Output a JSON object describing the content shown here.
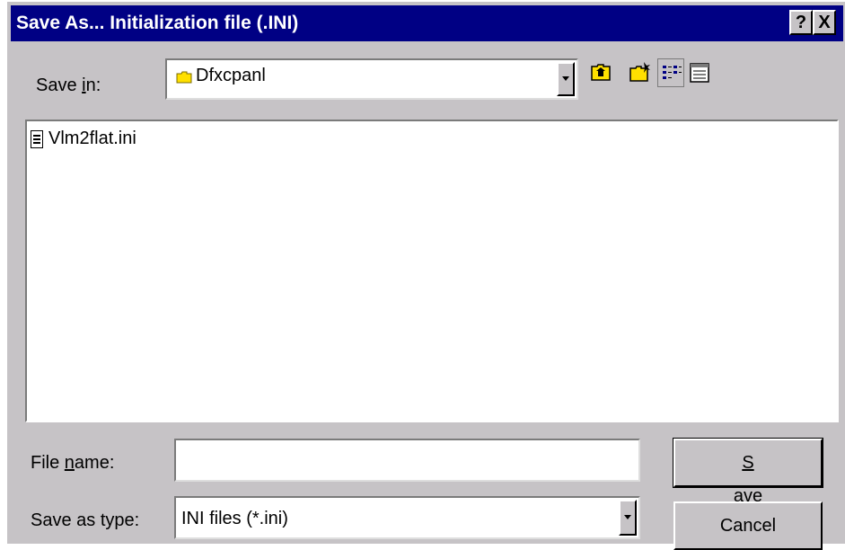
{
  "window": {
    "title": "Save As... Initialization file (.INI)",
    "help_button": "?",
    "close_button": "X"
  },
  "save_in": {
    "label_pre": "Save ",
    "label_accel": "i",
    "label_post": "n:",
    "value": "Dfxcpanl"
  },
  "toolbar": [
    {
      "icon": "up-one-level-icon"
    },
    {
      "icon": "create-new-folder-icon"
    },
    {
      "icon": "list-view-icon"
    },
    {
      "icon": "details-view-icon"
    }
  ],
  "files": [
    {
      "name": "Vlm2flat.ini",
      "icon": "ini-file-icon"
    }
  ],
  "file_name": {
    "label_pre": "File ",
    "label_accel": "n",
    "label_post": "ame:",
    "value": ""
  },
  "save_as_type": {
    "label": "Save as type:",
    "value": "INI files (*.ini)"
  },
  "buttons": {
    "save_accel": "S",
    "save_rest": "ave",
    "cancel": "Cancel"
  },
  "colors": {
    "titlebar": "#000084",
    "face": "#c6c3c6",
    "folder": "#ffe000"
  }
}
